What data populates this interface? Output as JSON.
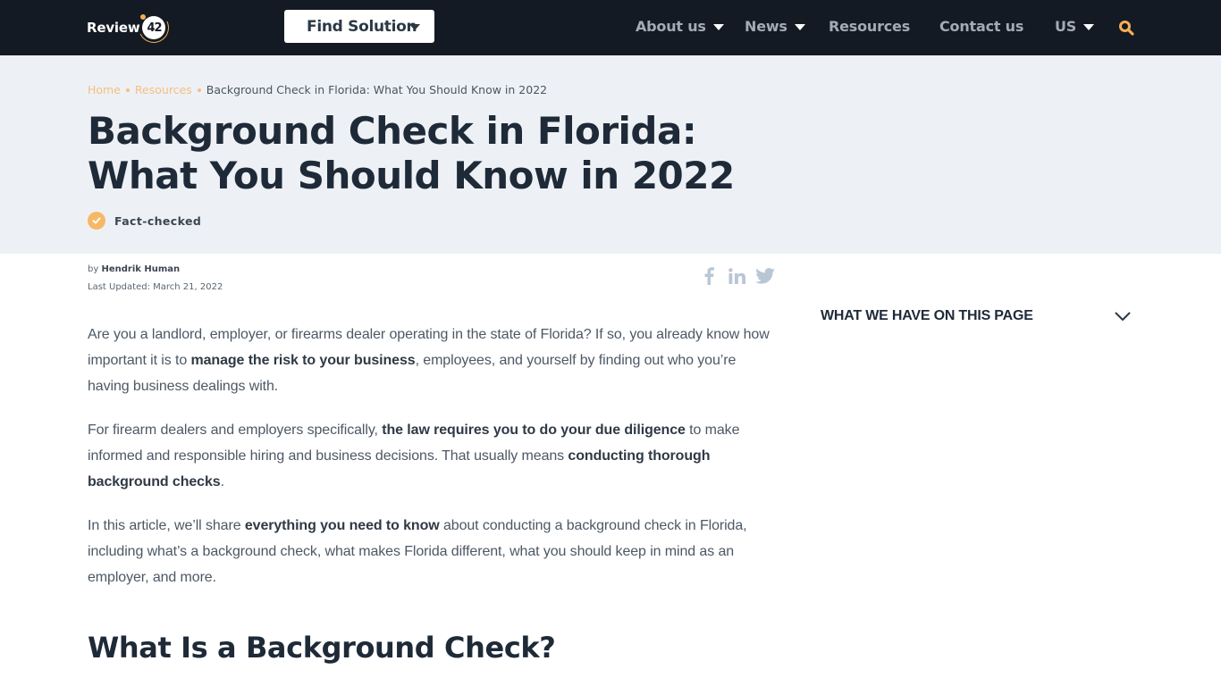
{
  "nav": {
    "logo_text": "Review",
    "logo_badge": "42",
    "find_solution": "Find Solution",
    "items": [
      {
        "label": "About us",
        "has_dropdown": true
      },
      {
        "label": "News",
        "has_dropdown": true
      },
      {
        "label": "Resources",
        "has_dropdown": false
      },
      {
        "label": "Contact us",
        "has_dropdown": false
      },
      {
        "label": "US",
        "has_dropdown": true
      }
    ],
    "search_icon": "search-icon"
  },
  "breadcrumb": {
    "items": [
      "Home",
      "Resources"
    ],
    "current": "Background Check in Florida: What You Should Know in 2022"
  },
  "title": "Background Check in Florida: What You Should Know in 2022",
  "fact_checked": "Fact-checked",
  "meta": {
    "by_prefix": "by",
    "author": "Hendrik Human",
    "updated": "Last Updated: March 21, 2022"
  },
  "share": [
    "facebook-icon",
    "linkedin-icon",
    "twitter-icon"
  ],
  "toc": {
    "label": "WHAT WE HAVE ON THIS PAGE"
  },
  "article": {
    "paragraphs": [
      [
        {
          "t": "Are you a landlord, employer, or firearms dealer operating in the state of Florida? If so, you already know how important it is to ",
          "b": false
        },
        {
          "t": "manage the risk to your business",
          "b": true
        },
        {
          "t": ", employees, and yourself by finding out who you’re having business dealings with.",
          "b": false
        }
      ],
      [
        {
          "t": "For firearm dealers and employers specifically, ",
          "b": false
        },
        {
          "t": "the law requires you to do your due diligence",
          "b": true
        },
        {
          "t": " to make informed and responsible hiring and business decisions. That usually means ",
          "b": false
        },
        {
          "t": "conducting thorough background checks",
          "b": true
        },
        {
          "t": ".",
          "b": false
        }
      ],
      [
        {
          "t": "In this article, we’ll share ",
          "b": false
        },
        {
          "t": "everything you need to know",
          "b": true
        },
        {
          "t": " about conducting a background check in Florida, including what’s a background check, what makes Florida different, what you should keep in mind as an employer, and more.",
          "b": false
        }
      ]
    ],
    "h2": "What Is a Background Check?"
  },
  "colors": {
    "nav_bg": "#141a23",
    "accent": "#f7ae56",
    "hero_bg": "#edf1f5",
    "heading": "#1f2a38",
    "body_text": "#4c5865",
    "share_icons": "#b9c6d4"
  }
}
